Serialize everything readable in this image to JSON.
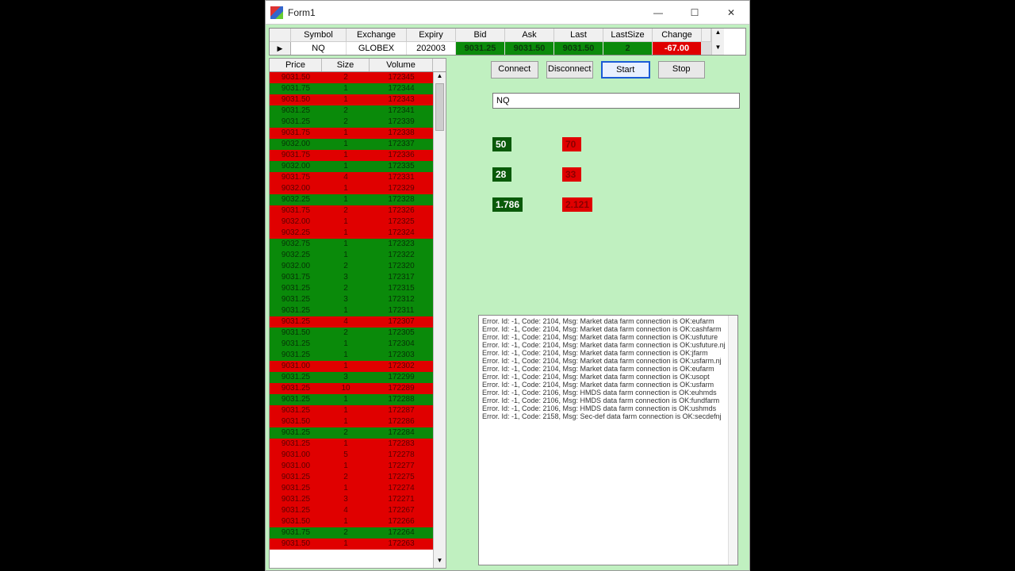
{
  "title": "Form1",
  "winbuttons": {
    "min": "—",
    "max": "☐",
    "close": "✕"
  },
  "summary": {
    "headers": [
      "Symbol",
      "Exchange",
      "Expiry",
      "Bid",
      "Ask",
      "Last",
      "LastSize",
      "Change"
    ],
    "row": {
      "symbol": "NQ",
      "exchange": "GLOBEX",
      "expiry": "202003",
      "bid": "9031.25",
      "ask": "9031.50",
      "last": "9031.50",
      "lastsize": "2",
      "change": "-67.00"
    }
  },
  "buttons": {
    "connect": "Connect",
    "disconnect": "Disconnect",
    "start": "Start",
    "stop": "Stop"
  },
  "symbol_input": "NQ",
  "stats": {
    "g1": "50",
    "r1": "70",
    "g2": "28",
    "r2": "33",
    "g3": "1.786",
    "r3": "2.121"
  },
  "ticks": {
    "headers": [
      "Price",
      "Size",
      "Volume"
    ],
    "rows": [
      {
        "p": "9031.50",
        "s": "2",
        "v": "172345",
        "d": "dn"
      },
      {
        "p": "9031.75",
        "s": "1",
        "v": "172344",
        "d": "up"
      },
      {
        "p": "9031.50",
        "s": "1",
        "v": "172343",
        "d": "dn"
      },
      {
        "p": "9031.25",
        "s": "2",
        "v": "172341",
        "d": "up"
      },
      {
        "p": "9031.25",
        "s": "2",
        "v": "172339",
        "d": "up"
      },
      {
        "p": "9031.75",
        "s": "1",
        "v": "172338",
        "d": "dn"
      },
      {
        "p": "9032.00",
        "s": "1",
        "v": "172337",
        "d": "up"
      },
      {
        "p": "9031.75",
        "s": "1",
        "v": "172336",
        "d": "dn"
      },
      {
        "p": "9032.00",
        "s": "1",
        "v": "172335",
        "d": "up"
      },
      {
        "p": "9031.75",
        "s": "4",
        "v": "172331",
        "d": "dn"
      },
      {
        "p": "9032.00",
        "s": "1",
        "v": "172329",
        "d": "dn"
      },
      {
        "p": "9032.25",
        "s": "1",
        "v": "172328",
        "d": "up"
      },
      {
        "p": "9031.75",
        "s": "2",
        "v": "172326",
        "d": "dn"
      },
      {
        "p": "9032.00",
        "s": "1",
        "v": "172325",
        "d": "dn"
      },
      {
        "p": "9032.25",
        "s": "1",
        "v": "172324",
        "d": "dn"
      },
      {
        "p": "9032.75",
        "s": "1",
        "v": "172323",
        "d": "up"
      },
      {
        "p": "9032.25",
        "s": "1",
        "v": "172322",
        "d": "up"
      },
      {
        "p": "9032.00",
        "s": "2",
        "v": "172320",
        "d": "up"
      },
      {
        "p": "9031.75",
        "s": "3",
        "v": "172317",
        "d": "up"
      },
      {
        "p": "9031.25",
        "s": "2",
        "v": "172315",
        "d": "up"
      },
      {
        "p": "9031.25",
        "s": "3",
        "v": "172312",
        "d": "up"
      },
      {
        "p": "9031.25",
        "s": "1",
        "v": "172311",
        "d": "up"
      },
      {
        "p": "9031.25",
        "s": "4",
        "v": "172307",
        "d": "dn"
      },
      {
        "p": "9031.50",
        "s": "2",
        "v": "172305",
        "d": "up"
      },
      {
        "p": "9031.25",
        "s": "1",
        "v": "172304",
        "d": "up"
      },
      {
        "p": "9031.25",
        "s": "1",
        "v": "172303",
        "d": "up"
      },
      {
        "p": "9031.00",
        "s": "1",
        "v": "172302",
        "d": "dn"
      },
      {
        "p": "9031.25",
        "s": "3",
        "v": "172299",
        "d": "up"
      },
      {
        "p": "9031.25",
        "s": "10",
        "v": "172289",
        "d": "dn"
      },
      {
        "p": "9031.25",
        "s": "1",
        "v": "172288",
        "d": "up"
      },
      {
        "p": "9031.25",
        "s": "1",
        "v": "172287",
        "d": "dn"
      },
      {
        "p": "9031.50",
        "s": "1",
        "v": "172286",
        "d": "dn"
      },
      {
        "p": "9031.25",
        "s": "2",
        "v": "172284",
        "d": "up"
      },
      {
        "p": "9031.25",
        "s": "1",
        "v": "172283",
        "d": "dn"
      },
      {
        "p": "9031.00",
        "s": "5",
        "v": "172278",
        "d": "dn"
      },
      {
        "p": "9031.00",
        "s": "1",
        "v": "172277",
        "d": "dn"
      },
      {
        "p": "9031.25",
        "s": "2",
        "v": "172275",
        "d": "dn"
      },
      {
        "p": "9031.25",
        "s": "1",
        "v": "172274",
        "d": "dn"
      },
      {
        "p": "9031.25",
        "s": "3",
        "v": "172271",
        "d": "dn"
      },
      {
        "p": "9031.25",
        "s": "4",
        "v": "172267",
        "d": "dn"
      },
      {
        "p": "9031.50",
        "s": "1",
        "v": "172266",
        "d": "dn"
      },
      {
        "p": "9031.75",
        "s": "2",
        "v": "172264",
        "d": "up"
      },
      {
        "p": "9031.50",
        "s": "1",
        "v": "172263",
        "d": "dn"
      }
    ]
  },
  "log_lines": [
    "Error. Id: -1, Code: 2104, Msg: Market data farm connection is OK:eufarm",
    "Error. Id: -1, Code: 2104, Msg: Market data farm connection is OK:cashfarm",
    "Error. Id: -1, Code: 2104, Msg: Market data farm connection is OK:usfuture",
    "Error. Id: -1, Code: 2104, Msg: Market data farm connection is OK:usfuture.nj",
    "Error. Id: -1, Code: 2104, Msg: Market data farm connection is OK:jfarm",
    "Error. Id: -1, Code: 2104, Msg: Market data farm connection is OK:usfarm.nj",
    "Error. Id: -1, Code: 2104, Msg: Market data farm connection is OK:eufarm",
    "Error. Id: -1, Code: 2104, Msg: Market data farm connection is OK:usopt",
    "Error. Id: -1, Code: 2104, Msg: Market data farm connection is OK:usfarm",
    "Error. Id: -1, Code: 2106, Msg: HMDS data farm connection is OK:euhmds",
    "Error. Id: -1, Code: 2106, Msg: HMDS data farm connection is OK:fundfarm",
    "Error. Id: -1, Code: 2106, Msg: HMDS data farm connection is OK:ushmds",
    "Error. Id: -1, Code: 2158, Msg: Sec-def data farm connection is OK:secdefnj"
  ]
}
